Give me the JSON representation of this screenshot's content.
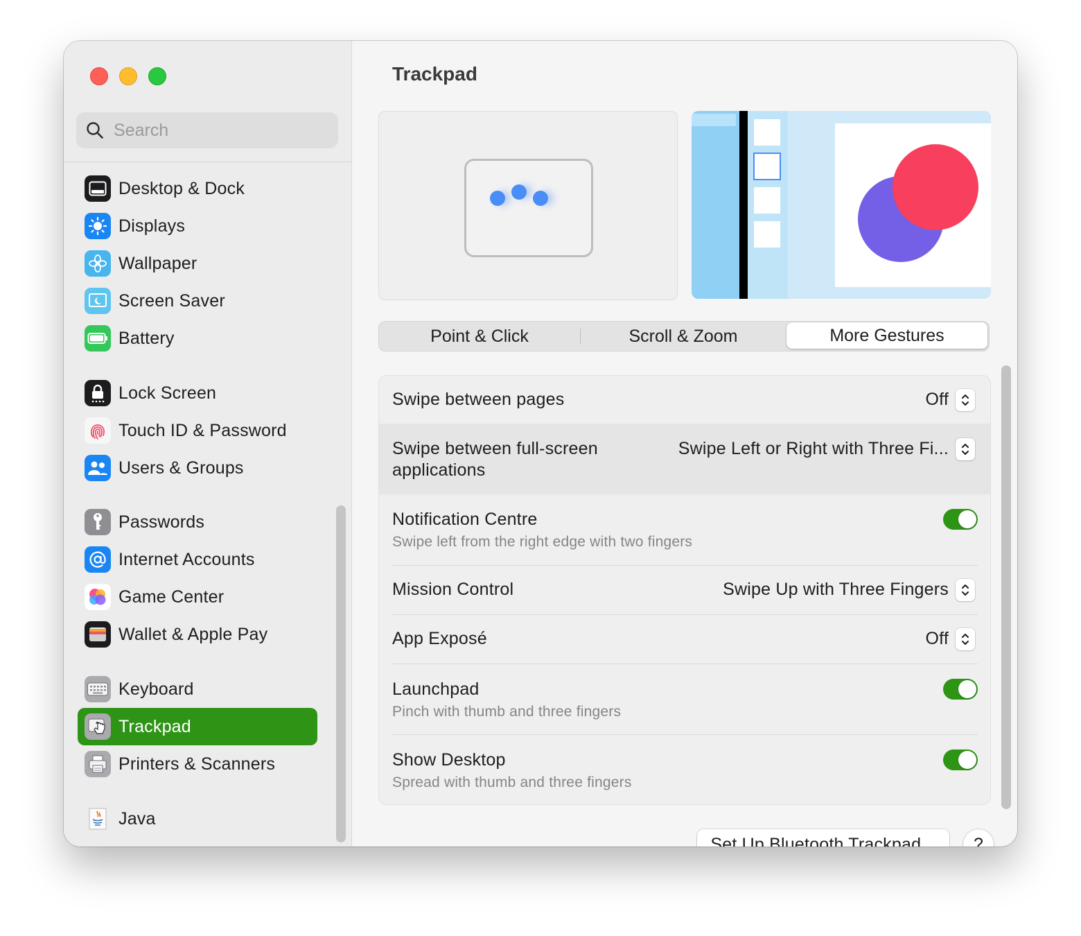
{
  "window": {
    "title": "Trackpad"
  },
  "search": {
    "placeholder": "Search"
  },
  "sidebar": {
    "items": [
      {
        "label": "Desktop & Dock",
        "icon": "dock-icon"
      },
      {
        "label": "Displays",
        "icon": "sun-icon"
      },
      {
        "label": "Wallpaper",
        "icon": "flower-icon"
      },
      {
        "label": "Screen Saver",
        "icon": "screensaver-icon"
      },
      {
        "label": "Battery",
        "icon": "battery-icon"
      },
      {
        "label": "Lock Screen",
        "icon": "lock-icon"
      },
      {
        "label": "Touch ID & Password",
        "icon": "fingerprint-icon"
      },
      {
        "label": "Users & Groups",
        "icon": "users-icon"
      },
      {
        "label": "Passwords",
        "icon": "key-icon"
      },
      {
        "label": "Internet Accounts",
        "icon": "at-icon"
      },
      {
        "label": "Game Center",
        "icon": "game-center-icon"
      },
      {
        "label": "Wallet & Apple Pay",
        "icon": "wallet-icon"
      },
      {
        "label": "Keyboard",
        "icon": "keyboard-icon"
      },
      {
        "label": "Trackpad",
        "icon": "trackpad-icon",
        "selected": true
      },
      {
        "label": "Printers & Scanners",
        "icon": "printer-icon"
      },
      {
        "label": "Java",
        "icon": "java-icon"
      }
    ]
  },
  "tabs": [
    {
      "label": "Point & Click",
      "selected": false
    },
    {
      "label": "Scroll & Zoom",
      "selected": false
    },
    {
      "label": "More Gestures",
      "selected": true
    }
  ],
  "settings": [
    {
      "title": "Swipe between pages",
      "value": "Off",
      "control": "popup"
    },
    {
      "title": "Swipe between full-screen",
      "title2": "applications",
      "value": "Swipe Left or Right with Three Fi...",
      "control": "popup"
    },
    {
      "title": "Notification Centre",
      "subtitle": "Swipe left from the right edge with two fingers",
      "control": "toggle",
      "on": true
    },
    {
      "title": "Mission Control",
      "value": "Swipe Up with Three Fingers",
      "control": "popup"
    },
    {
      "title": "App Exposé",
      "value": "Off",
      "control": "popup"
    },
    {
      "title": "Launchpad",
      "subtitle": "Pinch with thumb and three fingers",
      "control": "toggle",
      "on": true
    },
    {
      "title": "Show Desktop",
      "subtitle": "Spread with thumb and three fingers",
      "control": "toggle",
      "on": true
    }
  ],
  "footer": {
    "bluetooth_button": "Set Up Bluetooth Trackpad...",
    "help_label": "?"
  },
  "colors": {
    "accent": "#2e9416",
    "close": "#fe5f57",
    "minimize": "#febc2e",
    "zoom": "#28c840"
  }
}
